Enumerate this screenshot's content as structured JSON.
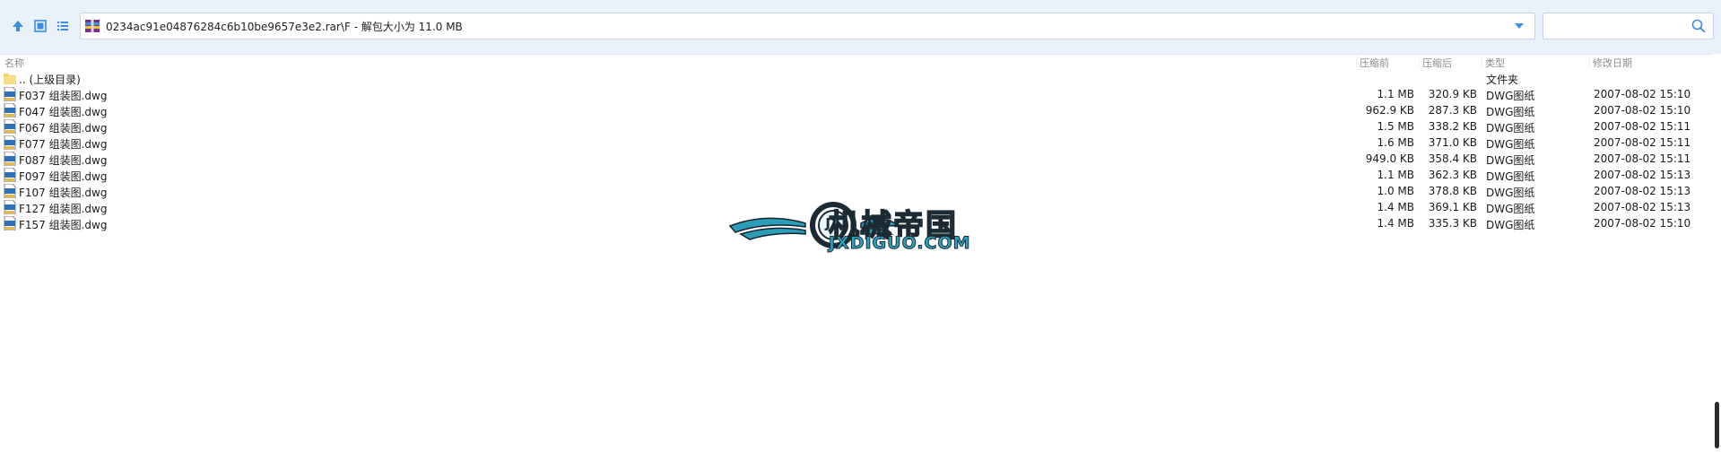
{
  "toolbar": {
    "path": "0234ac91e04876284c6b10be9657e3e2.rar\\F - 解包大小为 11.0 MB",
    "search_placeholder": ""
  },
  "columns": {
    "name": "名称",
    "size": "压缩前",
    "packed": "压缩后",
    "type": "类型",
    "date": "修改日期"
  },
  "parent_row": {
    "name": ".. (上级目录)",
    "type": "文件夹"
  },
  "files": [
    {
      "name": "F037 组装图.dwg",
      "size": "1.1 MB",
      "packed": "320.9 KB",
      "type": "DWG图纸",
      "date": "2007-08-02 15:10"
    },
    {
      "name": "F047 组装图.dwg",
      "size": "962.9 KB",
      "packed": "287.3 KB",
      "type": "DWG图纸",
      "date": "2007-08-02 15:10"
    },
    {
      "name": "F067 组装图.dwg",
      "size": "1.5 MB",
      "packed": "338.2 KB",
      "type": "DWG图纸",
      "date": "2007-08-02 15:11"
    },
    {
      "name": "F077 组装图.dwg",
      "size": "1.6 MB",
      "packed": "371.0 KB",
      "type": "DWG图纸",
      "date": "2007-08-02 15:11"
    },
    {
      "name": "F087 组装图.dwg",
      "size": "949.0 KB",
      "packed": "358.4 KB",
      "type": "DWG图纸",
      "date": "2007-08-02 15:11"
    },
    {
      "name": "F097 组装图.dwg",
      "size": "1.1 MB",
      "packed": "362.3 KB",
      "type": "DWG图纸",
      "date": "2007-08-02 15:13"
    },
    {
      "name": "F107 组装图.dwg",
      "size": "1.0 MB",
      "packed": "378.8 KB",
      "type": "DWG图纸",
      "date": "2007-08-02 15:13"
    },
    {
      "name": "F127 组装图.dwg",
      "size": "1.4 MB",
      "packed": "369.1 KB",
      "type": "DWG图纸",
      "date": "2007-08-02 15:13"
    },
    {
      "name": "F157 组装图.dwg",
      "size": "1.4 MB",
      "packed": "335.3 KB",
      "type": "DWG图纸",
      "date": "2007-08-02 15:10"
    }
  ],
  "watermark": {
    "cn": "机械帝国",
    "en": "JXDIGUO.COM",
    "badge": "JX"
  },
  "icons": {
    "up": "arrow-up-icon",
    "view_thumbnail": "thumbnail-view-icon",
    "view_list": "list-view-icon",
    "archive": "rar-archive-icon",
    "dropdown": "chevron-down-icon",
    "search": "search-icon",
    "folder": "folder-icon",
    "dwg": "dwg-file-icon"
  },
  "colors": {
    "toolbar_bg": "#e9f1fb",
    "accent": "#3b8ee0",
    "logo_teal": "#2a8fa5"
  }
}
